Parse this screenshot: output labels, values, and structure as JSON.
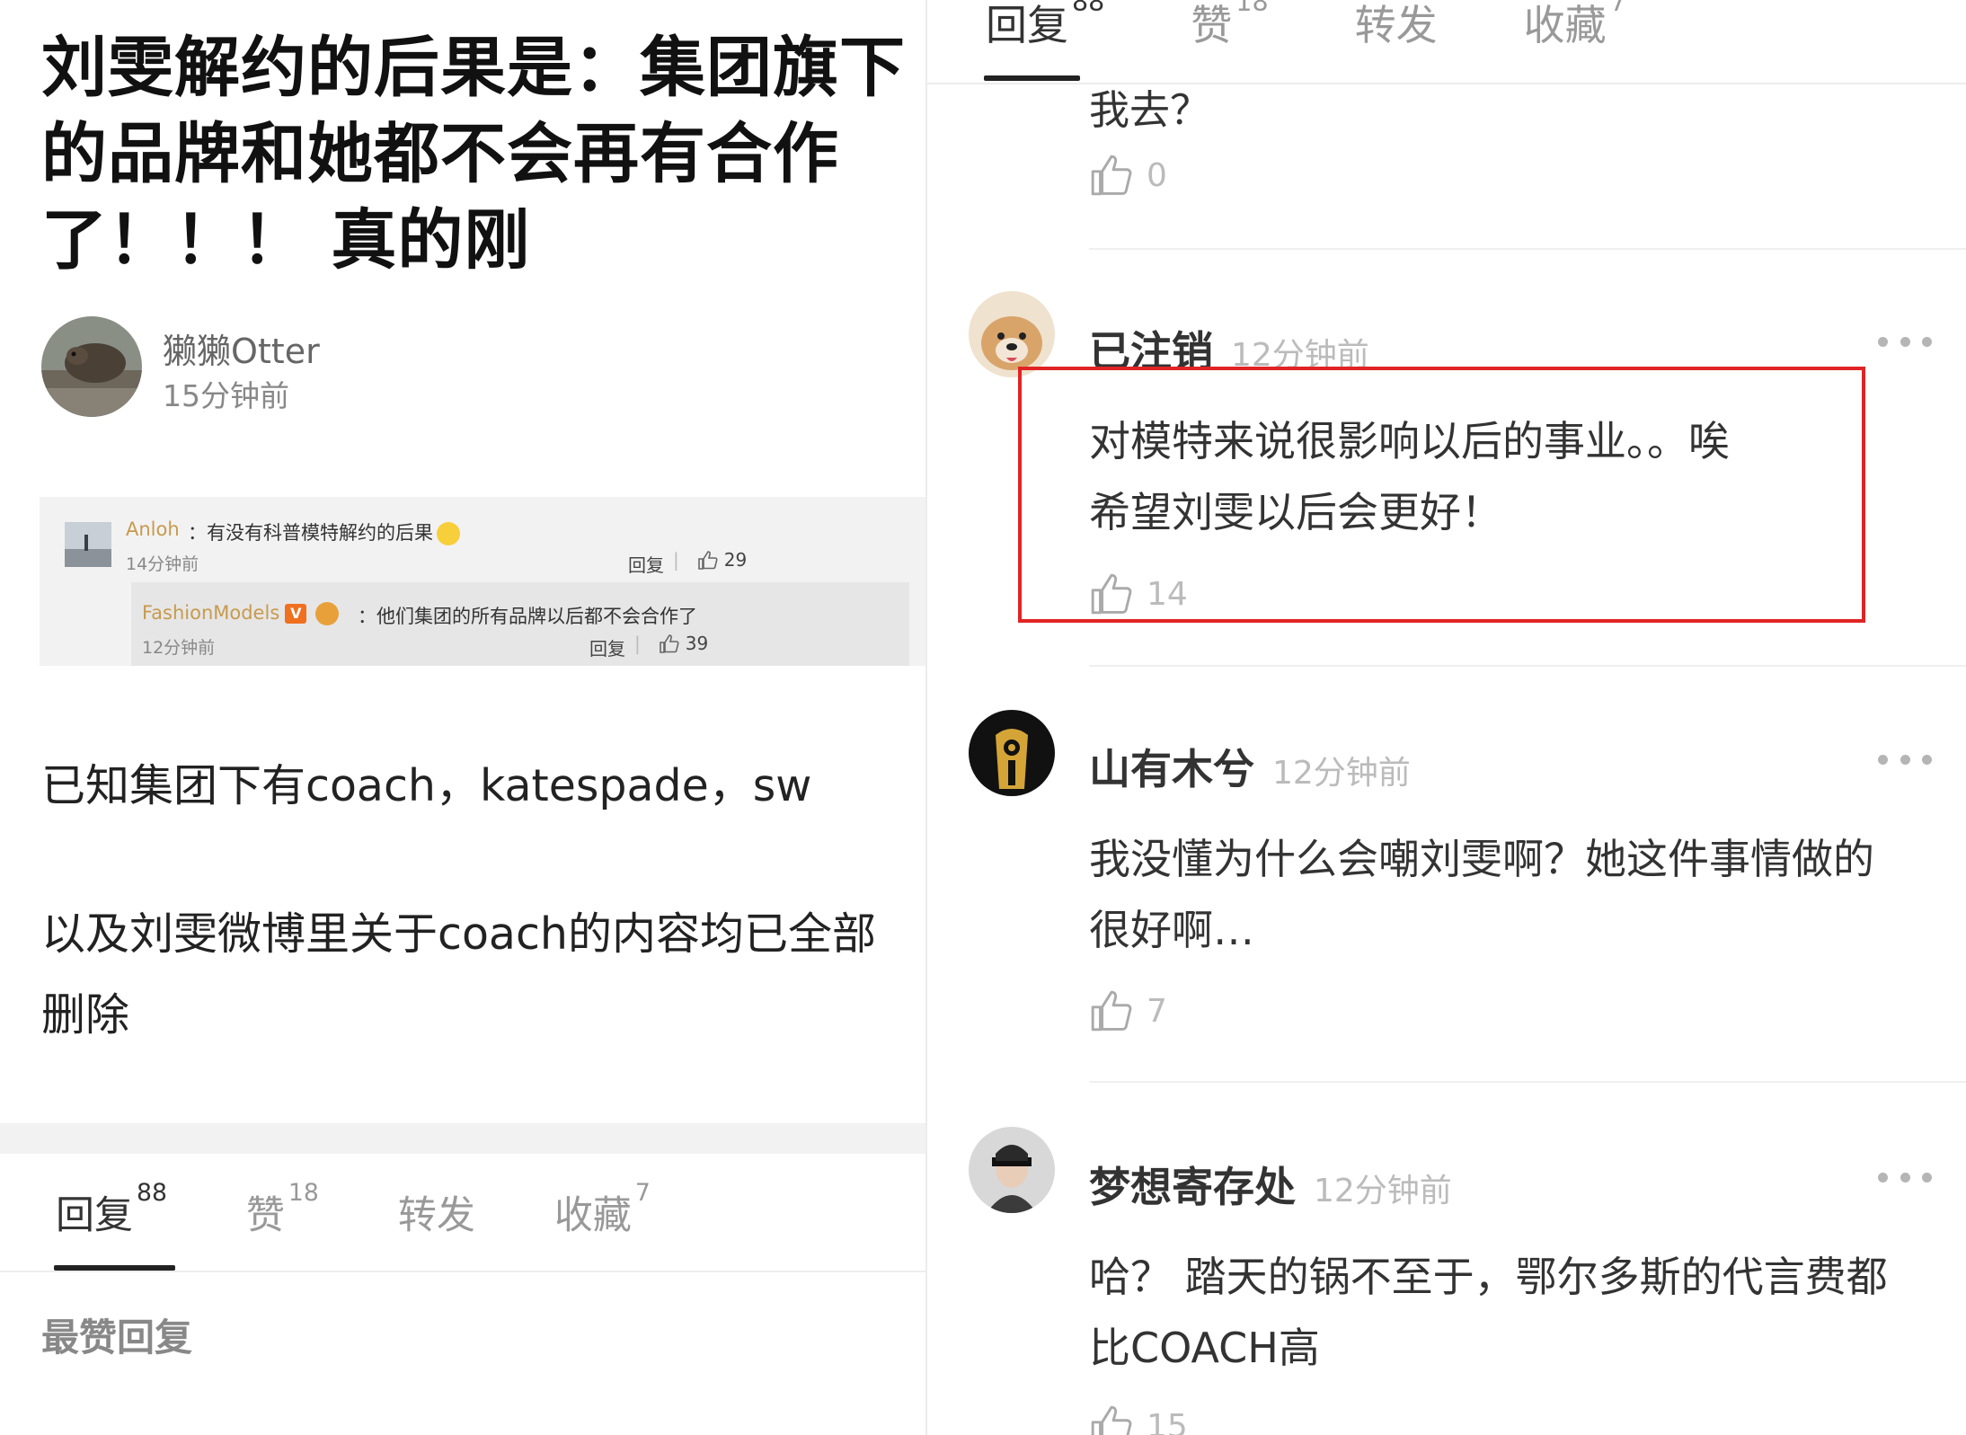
{
  "left": {
    "title": "刘雯解约的后果是：集团旗下的品牌和她都不会再有合作了！！！ 真的刚",
    "author": {
      "name": "獭獭Otter",
      "time": "15分钟前"
    },
    "screenshot": {
      "comment1": {
        "user": "Anloh",
        "text": "：有没有科普模特解约的后果",
        "time": "14分钟前",
        "reply": "回复",
        "likes": "29"
      },
      "comment2": {
        "user": "FashionModels",
        "badge": "V",
        "text": "：他们集团的所有品牌以后都不会合作了",
        "time": "12分钟前",
        "reply": "回复",
        "likes": "39"
      }
    },
    "body": {
      "line1": "已知集团下有coach，katespade，sw",
      "line2": "以及刘雯微博里关于coach的内容均已全部",
      "line3": "删除"
    },
    "tabs": [
      {
        "label": "回复",
        "count": "88"
      },
      {
        "label": "赞",
        "count": "18"
      },
      {
        "label": "转发",
        "count": ""
      },
      {
        "label": "收藏",
        "count": "7"
      }
    ],
    "section_title": "最赞回复"
  },
  "right": {
    "tabs": [
      {
        "label": "回复",
        "count": "88"
      },
      {
        "label": "赞",
        "count": "18"
      },
      {
        "label": "转发",
        "count": ""
      },
      {
        "label": "收藏",
        "count": "7"
      }
    ],
    "partial_comment": {
      "text": "我去？",
      "likes": "0"
    },
    "comments": [
      {
        "name": "已注销",
        "time": "12分钟前",
        "line1": "对模特来说很影响以后的事业。。唉",
        "line2": "希望刘雯以后会更好！",
        "likes": "14"
      },
      {
        "name": "山有木兮",
        "time": "12分钟前",
        "line1": "我没懂为什么会嘲刘雯啊？她这件事情做的",
        "line2": "很好啊…",
        "likes": "7"
      },
      {
        "name": "梦想寄存处",
        "time": "12分钟前",
        "line1": "哈？ 踏天的锅不至于，鄂尔多斯的代言费都",
        "line2": "比COACH高",
        "likes": "15"
      }
    ]
  },
  "colors": {
    "highlight_box": "#e02424",
    "username_gold": "#c89a4d",
    "muted": "#bbbbbb"
  },
  "icons": [
    "thumbs-up-icon",
    "more-dots-icon",
    "verified-badge-icon",
    "emoji-icon"
  ]
}
